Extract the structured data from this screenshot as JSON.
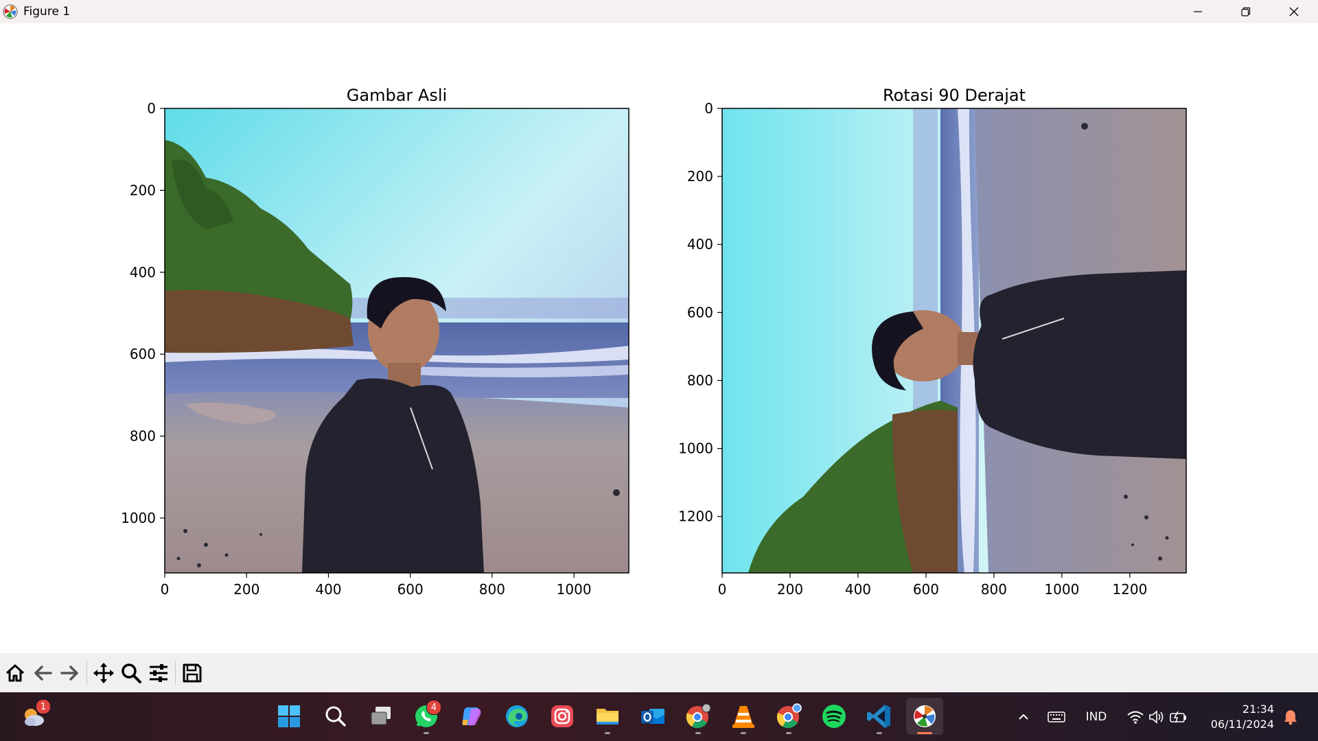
{
  "window": {
    "title": "Figure 1",
    "controls": [
      "minimize-icon",
      "restore-icon",
      "close-icon"
    ]
  },
  "figure": {
    "axes": [
      {
        "title": "Gambar Asli",
        "image": "original photo: man in dark jacket standing on a beach at dusk, cliff with trees on left, sea waves behind",
        "xticks": [
          "0",
          "200",
          "400",
          "600",
          "800",
          "1000"
        ],
        "yticks": [
          "0",
          "200",
          "400",
          "600",
          "800",
          "1000"
        ],
        "xlim": [
          0,
          1134
        ],
        "ylim": [
          1134,
          0
        ]
      },
      {
        "title": "Rotasi 90 Derajat",
        "image": "same photo rotated 90 degrees",
        "xticks": [
          "0",
          "200",
          "400",
          "600",
          "800",
          "1000",
          "1200"
        ],
        "yticks": [
          "0",
          "200",
          "400",
          "600",
          "800",
          "1000",
          "1200"
        ],
        "xlim": [
          0,
          1366
        ],
        "ylim": [
          1366,
          0
        ]
      }
    ]
  },
  "toolbar": {
    "tools": [
      "home-icon",
      "back-arrow-icon",
      "forward-arrow-icon",
      "pan-icon",
      "zoom-icon",
      "configure-subplots-icon",
      "save-icon"
    ]
  },
  "taskbar": {
    "weather_badge": "1",
    "whatsapp_badge": "4",
    "apps": [
      "start",
      "search",
      "task-view",
      "whatsapp",
      "copilot",
      "edge",
      "instagram",
      "file-explorer",
      "outlook",
      "chrome",
      "vlc",
      "chrome-profile",
      "spotify",
      "vscode",
      "python-figure"
    ],
    "tray": {
      "language": "IND",
      "time": "21:34",
      "date": "06/11/2024"
    }
  }
}
